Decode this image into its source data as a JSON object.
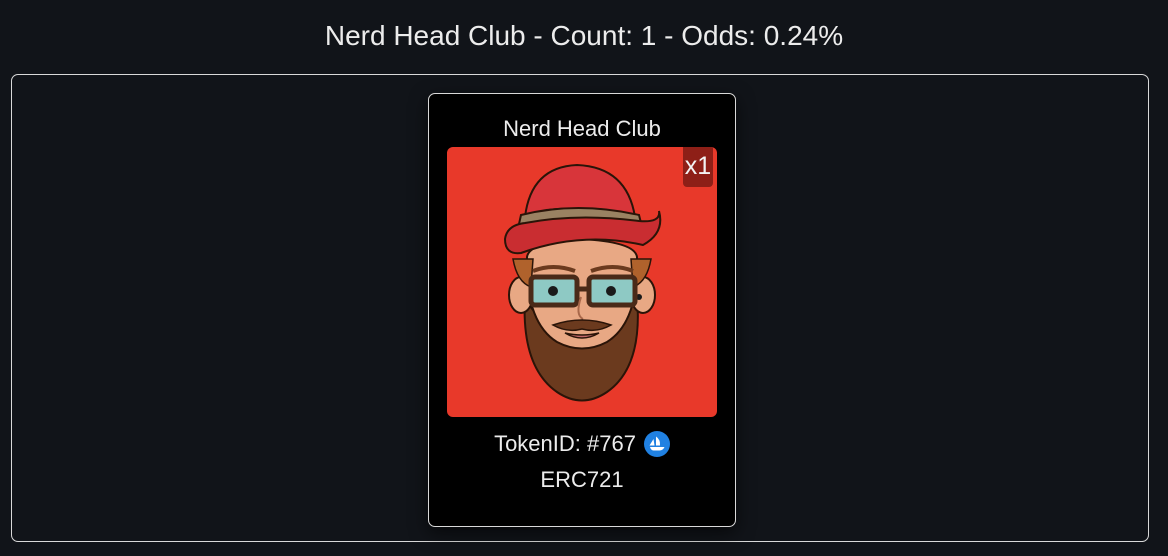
{
  "header": {
    "title": "Nerd Head Club - Count: 1 - Odds: 0.24%"
  },
  "card": {
    "collection_name": "Nerd Head Club",
    "count_badge": "x1",
    "token_label": "TokenID: #767",
    "standard": "ERC721",
    "marketplace_icon": "opensea-icon",
    "image_description_icon": "nerd-head-avatar"
  },
  "colors": {
    "background": "#111419",
    "card_background": "#000000",
    "image_background": "#e8392a",
    "badge_background": "#8e1f17",
    "opensea_blue": "#2081e2"
  }
}
